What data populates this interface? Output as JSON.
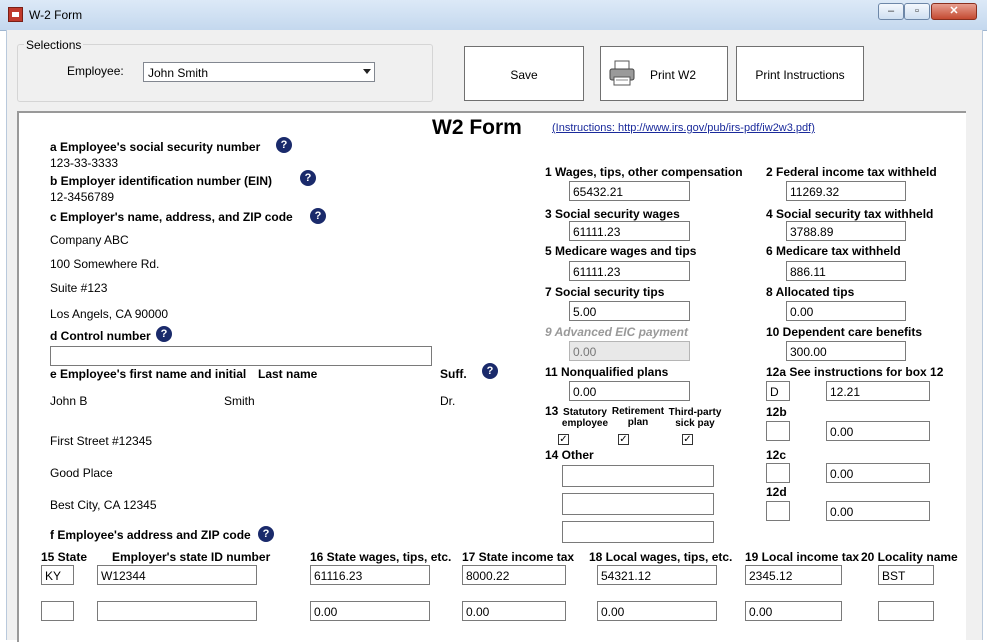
{
  "window": {
    "title": "W-2 Form"
  },
  "selections": {
    "group_title": "Selections",
    "employee_label": "Employee:",
    "employee_value": "John Smith"
  },
  "buttons": {
    "save": "Save",
    "print_w2": "Print W2",
    "print_instructions": "Print Instructions"
  },
  "form": {
    "title": "W2 Form",
    "instructions_link": "(Instructions: http://www.irs.gov/pub/irs-pdf/iw2w3.pdf)",
    "a_label": "a Employee's social security number",
    "a_value": "123-33-3333",
    "b_label": "b Employer identification number (EIN)",
    "b_value": "12-3456789",
    "c_label": "c Employer's name, address, and ZIP code",
    "c_line1": "Company ABC",
    "c_line2": "100 Somewhere Rd.",
    "c_line3": "Suite #123",
    "c_line4": "Los Angels, CA 90000",
    "d_label": "d Control number",
    "d_value": "",
    "e_label": "e Employee's first name and initial",
    "e_last_label": "Last name",
    "e_suff_label": "Suff.",
    "e_first": "John B",
    "e_last": "Smith",
    "e_suff": "Dr.",
    "addr_line1": "First Street #12345",
    "addr_line2": "Good Place",
    "addr_line3": "Best City, CA 12345",
    "f_label": "f Employee's address and ZIP code",
    "box1_label": "1 Wages, tips, other compensation",
    "box1": "65432.21",
    "box2_label": "2 Federal income tax withheld",
    "box2": "11269.32",
    "box3_label": "3 Social security wages",
    "box3": "61111.23",
    "box4_label": "4 Social security tax withheld",
    "box4": "3788.89",
    "box5_label": "5 Medicare wages and tips",
    "box5": "61111.23",
    "box6_label": "6 Medicare tax withheld",
    "box6": "886.11",
    "box7_label": "7 Social security tips",
    "box7": "5.00",
    "box8_label": "8 Allocated tips",
    "box8": "0.00",
    "box9_label": "9 Advanced EIC payment",
    "box9": "0.00",
    "box10_label": "10 Dependent care benefits",
    "box10": "300.00",
    "box11_label": "11 Nonqualified plans",
    "box11": "0.00",
    "box12a_label": "12a See instructions for box 12",
    "box12a_code": "D",
    "box12a": "12.21",
    "box12b_label": "12b",
    "box12b_code": "",
    "box12b": "0.00",
    "box12c_label": "12c",
    "box12c_code": "",
    "box12c": "0.00",
    "box12d_label": "12d",
    "box12d_code": "",
    "box12d": "0.00",
    "box13_label": "13",
    "box13_statutory": "Statutory employee",
    "box13_statutory_l1": "Statutory",
    "box13_statutory_l2": "employee",
    "box13_retirement_l1": "Retirement",
    "box13_retirement_l2": "plan",
    "box13_thirdparty_l1": "Third-party",
    "box13_thirdparty_l2": "sick pay",
    "box14_label": "14 Other",
    "box14_1": "",
    "box14_2": "",
    "box14_3": "",
    "box15_label": "15 State",
    "employer_state_id_label": "Employer's state ID number",
    "box16_label": "16 State wages, tips, etc.",
    "box17_label": "17 State income tax",
    "box18_label": "18 Local wages, tips, etc.",
    "box19_label": "19 Local income tax",
    "box20_label": "20 Locality name",
    "row1": {
      "state": "KY",
      "state_id": "W12344",
      "state_wages": "61116.23",
      "state_tax": "8000.22",
      "local_wages": "54321.12",
      "local_tax": "2345.12",
      "locality": "BST"
    },
    "row2": {
      "state": "",
      "state_id": "",
      "state_wages": "0.00",
      "state_tax": "0.00",
      "local_wages": "0.00",
      "local_tax": "0.00",
      "locality": ""
    }
  },
  "help_glyph": "?",
  "check_glyph": "✓"
}
